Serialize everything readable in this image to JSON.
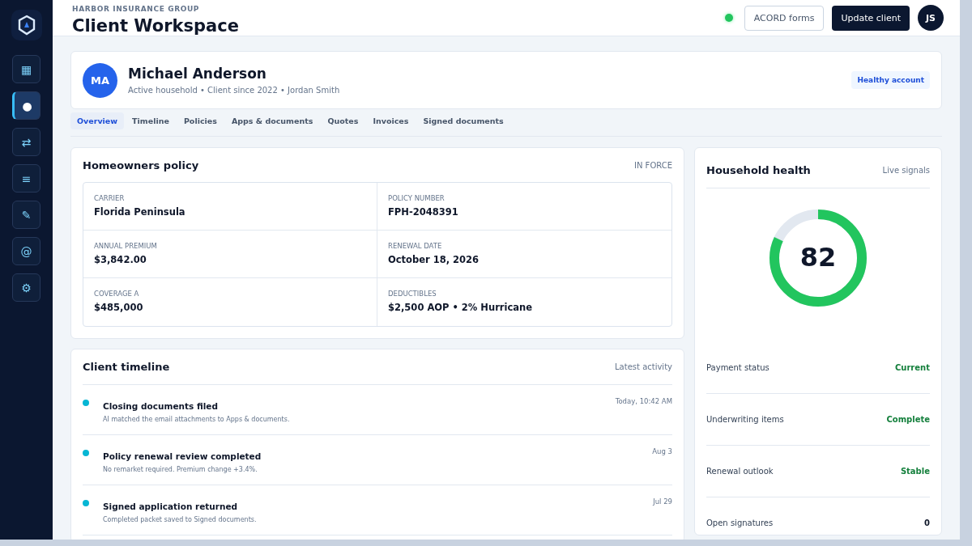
{
  "sidebar": {
    "items": [
      {
        "icon": "▦",
        "selected": false
      },
      {
        "icon": "●",
        "selected": true
      },
      {
        "icon": "⇄",
        "selected": false
      },
      {
        "icon": "≡",
        "selected": false
      },
      {
        "icon": "✎",
        "selected": false
      },
      {
        "icon": "@",
        "selected": false
      },
      {
        "icon": "⚙",
        "selected": false
      }
    ]
  },
  "header": {
    "org": "HARBOR INSURANCE GROUP",
    "title": "Client Workspace",
    "online": true,
    "buttons": [
      {
        "label": "ACORD forms",
        "kind": "secondary"
      },
      {
        "label": "Update client",
        "kind": "primary"
      }
    ],
    "user_initials": "JS"
  },
  "client": {
    "initials": "MA",
    "name": "Michael Anderson",
    "meta": "Active household • Client since 2022 • Jordan Smith",
    "badge": "Healthy account"
  },
  "tabs": [
    {
      "label": "Overview",
      "selected": true
    },
    {
      "label": "Timeline",
      "selected": false
    },
    {
      "label": "Policies",
      "selected": false
    },
    {
      "label": "Apps & documents",
      "selected": false
    },
    {
      "label": "Quotes",
      "selected": false
    },
    {
      "label": "Invoices",
      "selected": false
    },
    {
      "label": "Signed documents",
      "selected": false
    }
  ],
  "policy": {
    "title": "Homeowners policy",
    "status": "IN FORCE",
    "fields": [
      {
        "label": "CARRIER",
        "value": "Florida Peninsula"
      },
      {
        "label": "POLICY NUMBER",
        "value": "FPH-2048391"
      },
      {
        "label": "ANNUAL PREMIUM",
        "value": "$3,842.00"
      },
      {
        "label": "RENEWAL DATE",
        "value": "October 18, 2026"
      },
      {
        "label": "COVERAGE A",
        "value": "$485,000"
      },
      {
        "label": "DEDUCTIBLES",
        "value": "$2,500 AOP • 2% Hurricane"
      }
    ]
  },
  "timeline": {
    "title": "Client timeline",
    "caption": "Latest activity",
    "events": [
      {
        "title": "Closing documents filed",
        "detail": "AI matched the email attachments to Apps & documents.",
        "time": "Today, 10:42 AM"
      },
      {
        "title": "Policy renewal review completed",
        "detail": "No remarket required. Premium change +3.4%.",
        "time": "Aug 3"
      },
      {
        "title": "Signed application returned",
        "detail": "Completed packet saved to Signed documents.",
        "time": "Jul 29"
      }
    ]
  },
  "health": {
    "title": "Household health",
    "caption": "Live signals",
    "score": "82",
    "level": 0.82,
    "signals": [
      {
        "label": "Payment status",
        "value": "Current",
        "kind": "good"
      },
      {
        "label": "Underwriting items",
        "value": "Complete",
        "kind": "good"
      },
      {
        "label": "Renewal outlook",
        "value": "Stable",
        "kind": "good"
      },
      {
        "label": "Open signatures",
        "value": "0",
        "kind": "neutral"
      }
    ]
  }
}
